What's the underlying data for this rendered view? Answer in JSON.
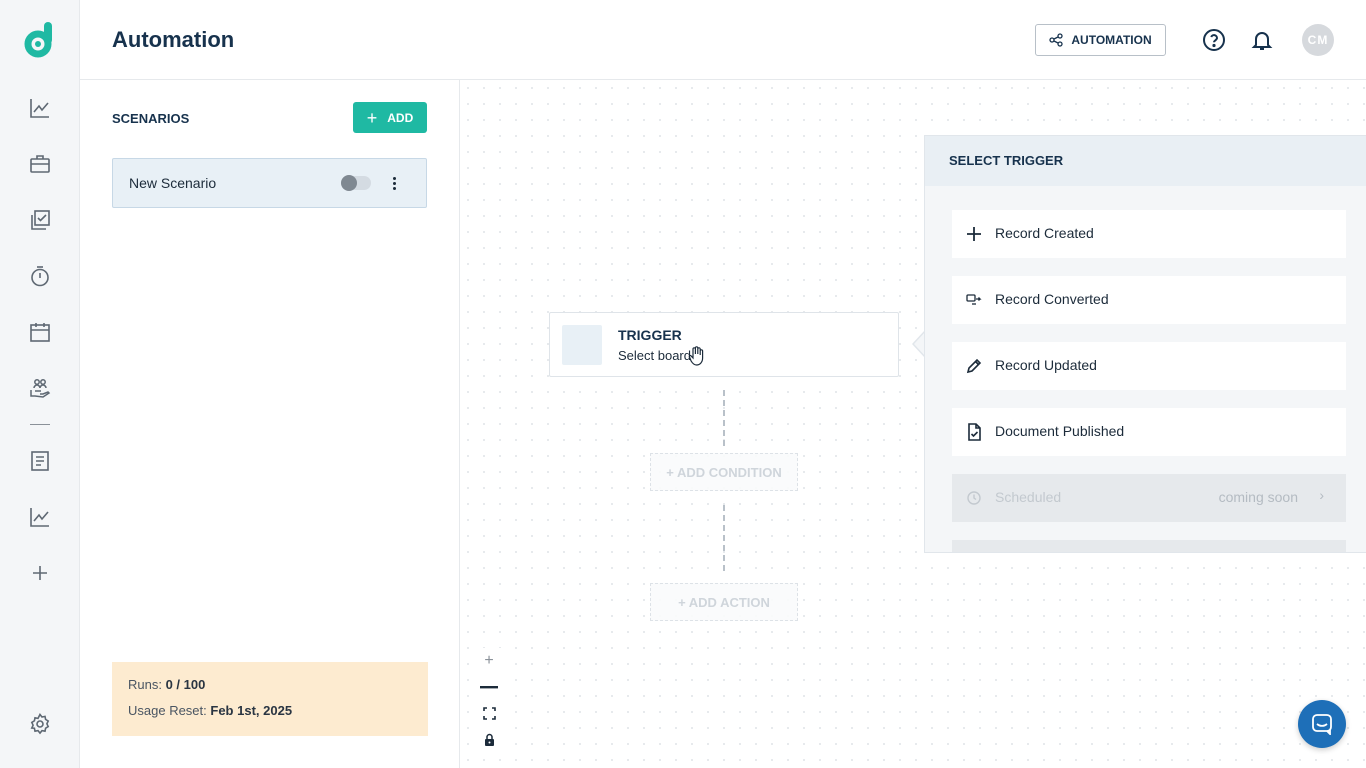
{
  "app": {
    "logo": "dotdigital-logo-icon",
    "brand_color": "#1fb9a3",
    "accent_color": "#17324d"
  },
  "sidebar": {
    "items": [
      {
        "name": "analytics",
        "icon": "line-chart-icon"
      },
      {
        "name": "briefcase",
        "icon": "briefcase-icon"
      },
      {
        "name": "tasks",
        "icon": "checklist-icon"
      },
      {
        "name": "timer",
        "icon": "stopwatch-icon"
      },
      {
        "name": "calendar",
        "icon": "calendar-icon"
      },
      {
        "name": "customers",
        "icon": "hand-people-icon"
      },
      {
        "name": "documents",
        "icon": "document-icon"
      },
      {
        "name": "reports",
        "icon": "line-chart-icon"
      },
      {
        "name": "add",
        "icon": "plus-icon"
      },
      {
        "name": "settings",
        "icon": "gear-icon"
      }
    ]
  },
  "header": {
    "title": "Automation",
    "automation_label": "AUTOMATION",
    "avatar_initials": "CM"
  },
  "scenarios": {
    "title": "SCENARIOS",
    "add_label": "ADD",
    "items": [
      {
        "name": "New Scenario",
        "enabled": false
      }
    ],
    "usage": {
      "runs_label": "Runs:",
      "runs_value": "0 / 100",
      "reset_label": "Usage Reset:",
      "reset_value": "Feb 1st, 2025"
    }
  },
  "canvas": {
    "trigger": {
      "title": "TRIGGER",
      "subtitle": "Select board"
    },
    "add_condition_label": "+ ADD CONDITION",
    "add_action_label": "+ ADD ACTION",
    "zoom_controls": [
      "zoom-in",
      "zoom-out",
      "fit-view",
      "lock"
    ]
  },
  "trigger_panel": {
    "title": "SELECT TRIGGER",
    "items": [
      {
        "label": "Record Created",
        "icon": "plus-icon",
        "disabled": false
      },
      {
        "label": "Record Converted",
        "icon": "convert-icon",
        "disabled": false
      },
      {
        "label": "Record Updated",
        "icon": "pencil-icon",
        "disabled": false
      },
      {
        "label": "Document Published",
        "icon": "document-check-icon",
        "disabled": false
      },
      {
        "label": "Scheduled",
        "icon": "clock-icon",
        "disabled": true,
        "badge": "coming soon"
      }
    ]
  }
}
